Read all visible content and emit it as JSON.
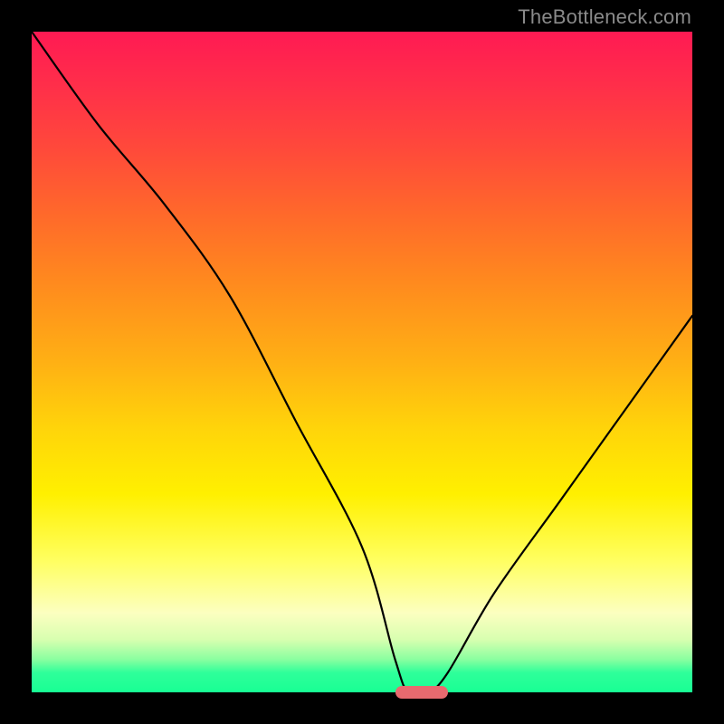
{
  "watermark": "TheBottleneck.com",
  "chart_data": {
    "type": "line",
    "title": "",
    "xlabel": "",
    "ylabel": "",
    "xlim": [
      0,
      100
    ],
    "ylim": [
      0,
      100
    ],
    "grid": false,
    "legend": false,
    "series": [
      {
        "name": "bottleneck-curve",
        "x": [
          0,
          10,
          20,
          30,
          40,
          50,
          55,
          57,
          60,
          63,
          70,
          80,
          90,
          100
        ],
        "values": [
          100,
          86,
          74,
          60,
          41,
          22,
          5,
          0,
          0,
          3,
          15,
          29,
          43,
          57
        ]
      }
    ],
    "annotations": [
      {
        "name": "optimal-marker",
        "x_start": 55,
        "x_end": 63,
        "y": 0,
        "color": "#e76a6f"
      }
    ],
    "gradient_stops": [
      {
        "pct": 0,
        "color": "#ff1a53"
      },
      {
        "pct": 50,
        "color": "#ffb014"
      },
      {
        "pct": 80,
        "color": "#ffff60"
      },
      {
        "pct": 100,
        "color": "#18ff94"
      }
    ]
  }
}
